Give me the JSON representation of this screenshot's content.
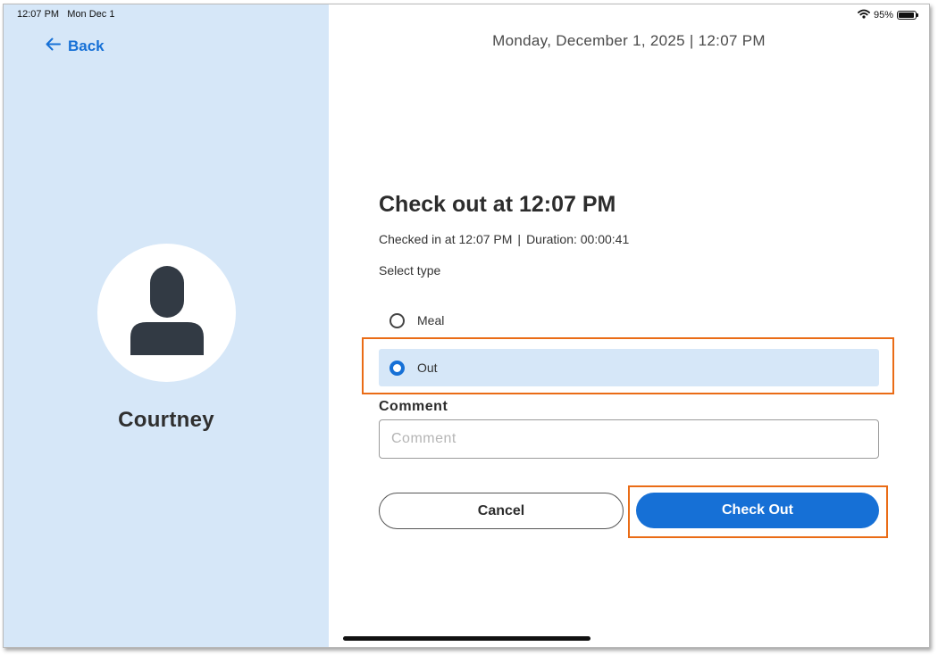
{
  "status_bar": {
    "time": "12:07 PM",
    "date": "Mon Dec 1",
    "battery": "95%",
    "battery_level": 0.95
  },
  "nav": {
    "back_label": "Back"
  },
  "profile": {
    "name": "Courtney"
  },
  "header": {
    "datetime": "Monday, December 1, 2025 | 12:07 PM"
  },
  "form": {
    "title": "Check out at 12:07 PM",
    "checked_in": "Checked in at 12:07 PM",
    "duration": "Duration: 00:00:41",
    "select_type_label": "Select type",
    "options": [
      {
        "label": "Meal",
        "selected": false
      },
      {
        "label": "Out",
        "selected": true
      }
    ],
    "comment_label": "Comment",
    "comment_placeholder": "Comment",
    "comment_value": ""
  },
  "actions": {
    "cancel_label": "Cancel",
    "checkout_label": "Check Out"
  },
  "colors": {
    "accent": "#1670d6",
    "sidebar_bg": "#d6e7f8",
    "highlight": "#ea6c16"
  }
}
